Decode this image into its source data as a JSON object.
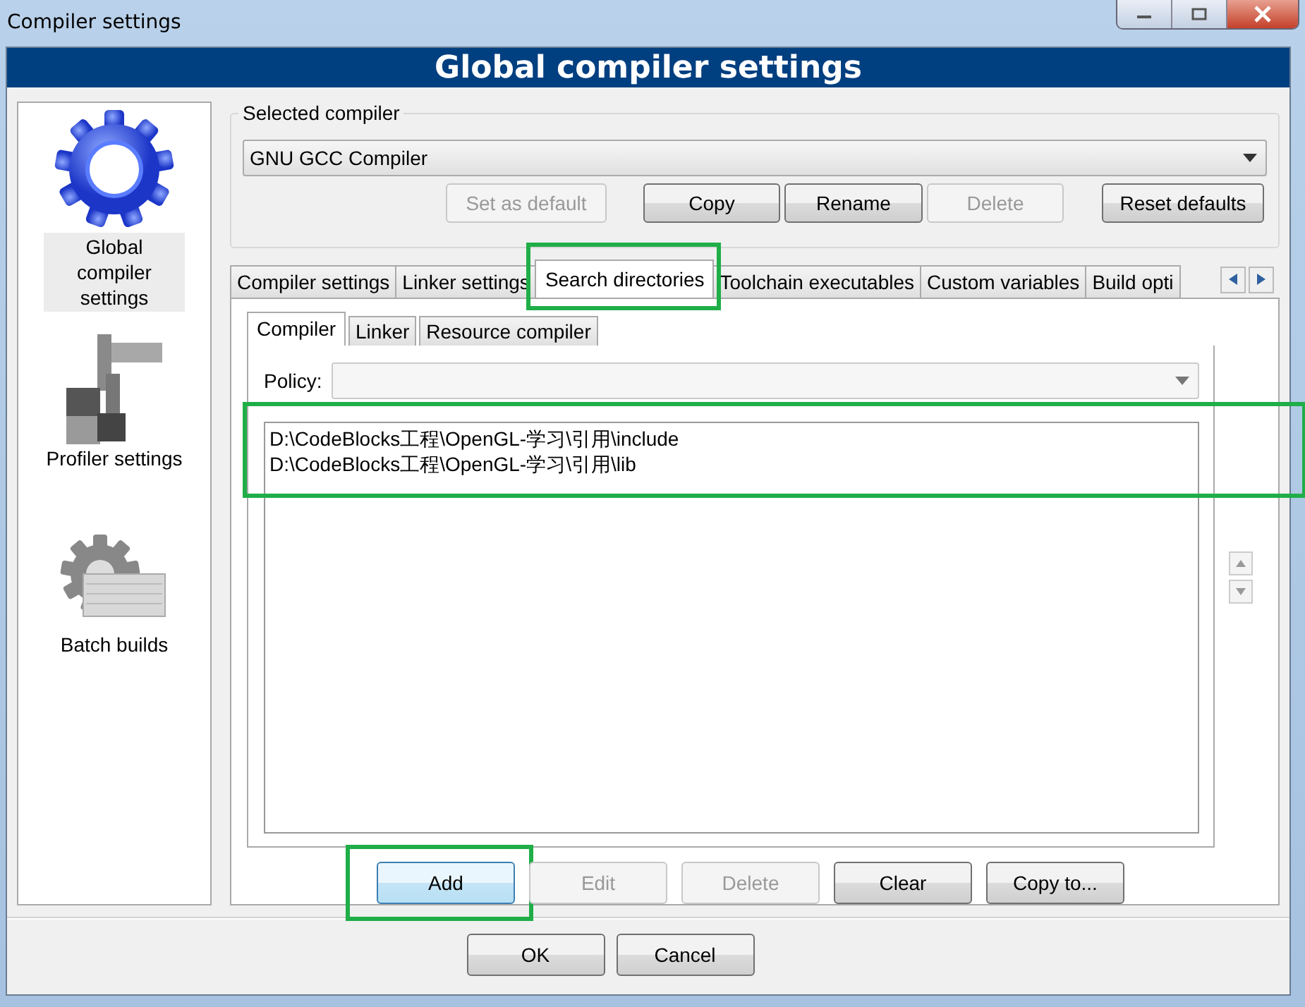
{
  "window": {
    "title": "Compiler settings"
  },
  "header": {
    "title": "Global compiler settings"
  },
  "sidebar": {
    "items": [
      {
        "label": "Global compiler settings",
        "selected": true
      },
      {
        "label": "Profiler settings",
        "selected": false
      },
      {
        "label": "Batch builds",
        "selected": false
      }
    ]
  },
  "selected_compiler": {
    "label": "Selected compiler",
    "value": "GNU GCC Compiler",
    "buttons": [
      {
        "label": "Set as default",
        "disabled": true
      },
      {
        "label": "Copy",
        "disabled": false
      },
      {
        "label": "Rename",
        "disabled": false
      },
      {
        "label": "Delete",
        "disabled": true
      },
      {
        "label": "Reset defaults",
        "disabled": false
      }
    ]
  },
  "tabs": [
    {
      "label": "Compiler settings",
      "selected": false,
      "highlighted": false
    },
    {
      "label": "Linker settings",
      "selected": false,
      "highlighted": false
    },
    {
      "label": "Search directories",
      "selected": true,
      "highlighted": true
    },
    {
      "label": "Toolchain executables",
      "selected": false,
      "highlighted": false
    },
    {
      "label": "Custom variables",
      "selected": false,
      "highlighted": false
    },
    {
      "label": "Build opti",
      "selected": false,
      "highlighted": false
    }
  ],
  "subtabs": [
    {
      "label": "Compiler",
      "selected": true
    },
    {
      "label": "Linker",
      "selected": false
    },
    {
      "label": "Resource compiler",
      "selected": false
    }
  ],
  "policy": {
    "label": "Policy:"
  },
  "directories": {
    "highlighted": true,
    "items": [
      "D:\\CodeBlocks工程\\OpenGL-学习\\引用\\include",
      "D:\\CodeBlocks工程\\OpenGL-学习\\引用\\lib"
    ]
  },
  "directory_buttons": [
    {
      "label": "Add",
      "disabled": false,
      "focused": true,
      "highlighted": true
    },
    {
      "label": "Edit",
      "disabled": true,
      "focused": false,
      "highlighted": false
    },
    {
      "label": "Delete",
      "disabled": true,
      "focused": false,
      "highlighted": false
    },
    {
      "label": "Clear",
      "disabled": false,
      "focused": false,
      "highlighted": false
    },
    {
      "label": "Copy to...",
      "disabled": false,
      "focused": false,
      "highlighted": false
    }
  ],
  "dialog_buttons": [
    {
      "label": "OK"
    },
    {
      "label": "Cancel"
    }
  ]
}
